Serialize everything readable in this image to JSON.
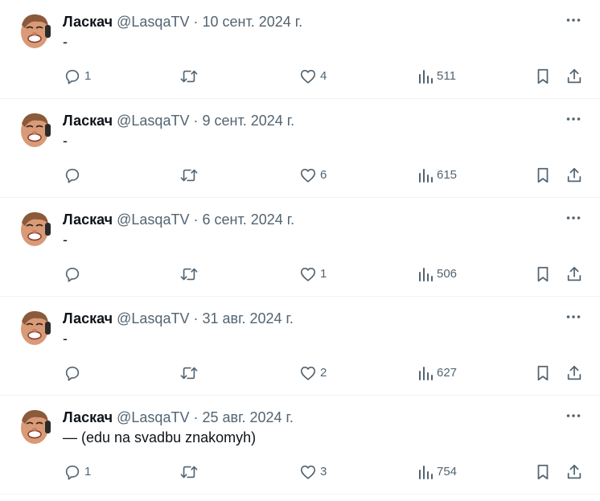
{
  "colors": {
    "text_primary": "#0f1419",
    "text_secondary": "#536471",
    "divider": "#eff3f4"
  },
  "icons": {
    "more": "more-horizontal-icon",
    "reply": "reply-bubble-icon",
    "retweet": "retweet-arrows-icon",
    "like": "heart-icon",
    "views": "bar-chart-icon",
    "bookmark": "bookmark-icon",
    "share": "share-upload-icon"
  },
  "tweets": [
    {
      "name": "Ласкач",
      "handle": "@LasqaTV",
      "separator": "·",
      "date": "10 сент. 2024 г.",
      "text": "-",
      "replies": "1",
      "retweets": "",
      "likes": "4",
      "views": "511"
    },
    {
      "name": "Ласкач",
      "handle": "@LasqaTV",
      "separator": "·",
      "date": "9 сент. 2024 г.",
      "text": "-",
      "replies": "",
      "retweets": "",
      "likes": "6",
      "views": "615"
    },
    {
      "name": "Ласкач",
      "handle": "@LasqaTV",
      "separator": "·",
      "date": "6 сент. 2024 г.",
      "text": "-",
      "replies": "",
      "retweets": "",
      "likes": "1",
      "views": "506"
    },
    {
      "name": "Ласкач",
      "handle": "@LasqaTV",
      "separator": "·",
      "date": "31 авг. 2024 г.",
      "text": "-",
      "replies": "",
      "retweets": "",
      "likes": "2",
      "views": "627"
    },
    {
      "name": "Ласкач",
      "handle": "@LasqaTV",
      "separator": "·",
      "date": "25 авг. 2024 г.",
      "text": "— (edu na svadbu znakomyh)",
      "replies": "1",
      "retweets": "",
      "likes": "3",
      "views": "754"
    }
  ]
}
